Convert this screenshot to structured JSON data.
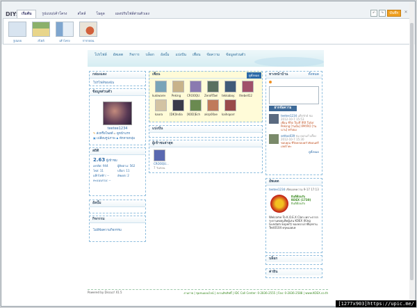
{
  "diy": {
    "title": "DIY:",
    "tabs": [
      "เริ่มต้น",
      "รูปแบบ/เค้าโครง",
      "สไตล์",
      "โมดูล",
      "แผงปรับไฟล์ส่วนตัวเอง"
    ],
    "save_label": "บันทึก",
    "layouts": [
      {
        "label": "รูปแบบ",
        "color": "#d8e4f0"
      },
      {
        "label": "สไตล์",
        "color": "#8bb06a"
      },
      {
        "label": "เค้าโครง",
        "color": "#7fa6cf"
      },
      {
        "label": "การกลอน",
        "color": "#d2603a"
      }
    ]
  },
  "nav": {
    "items": [
      "โปรไฟล์",
      "อัพเดต",
      "กิจการ",
      "บล็อก",
      "อัลบั้ม",
      "แบ่งปัน",
      "เพื่อน",
      "ข้อความ",
      "ข้อมูลส่วนตัว"
    ]
  },
  "left": {
    "box1_title": "กล่องแดง",
    "box1_link": "โปรไฟล์ของฉัน",
    "box2_title": "ข้อมูลส่วนตัว",
    "username": "teetee1234",
    "links": [
      "ส่งหรือโพสต์",
      "ดูหน้าแรก",
      "เปลี่ยนรูปภาพ",
      "ทักทายกลุ่ม"
    ],
    "box3_title": "สถิติ",
    "stat_main": "2.63",
    "stat_main_label": "ผู้เข้าชม",
    "stats": [
      "เครดิต: 944",
      "ผู้ติดตาม: 562",
      "โพส: 11",
      "บล็อก: 11",
      "แท็กไฟฟ้า: --",
      "อัพเดต: 2",
      "คะแนนรวม: --"
    ],
    "box4_title": "อัลบั้ม",
    "box5_title": "กิจกรรม",
    "box5_link": "ไม่มีข้อความกิจกรรม"
  },
  "center": {
    "friends_title": "เพื่อน",
    "friends_tag": "ดูทั้งหมด",
    "friends": [
      "kukiwaree",
      "Peking",
      "CROOQU...",
      "ZeroRTaeb...",
      "tekkaboy37",
      "thebell126",
      "kaora",
      "[DK]Indiana",
      "[KOD]Ech...",
      "akrp00ae79",
      "kaihoporn"
    ],
    "share_title": "แบ่งปัน",
    "visitors_title": "ผู้เข้าชมล่าสุด",
    "visitor_name": "CROOQU...",
    "visitor_time": "7 วันก่อน"
  },
  "right": {
    "wall_title": "ทางหน้าบ้าน",
    "wall_more": "ทั้งหมด",
    "post_button": "ฝากข้อความ",
    "posts": [
      {
        "name": "teetee1234",
        "meta": "แท็กรักษ์ ชม 2012-10-7 15:53",
        "text": "เพื่อน ชีวิต Tsuff IRR Tutor Peking [วันนั้น] IPAYRO [วันนาน] ครับผม"
      },
      {
        "name": "settoo039",
        "meta": "ชม ดอกแก้วเลี้ยง 2012-10-7 15:30",
        "text": "ขอบคุณ ชีวิตครอบครัวฟังดนตรีเลยจ้าคะ"
      }
    ],
    "posts_more": "ดูทั้งหมด",
    "feed_title": "อัพเดต",
    "feed_user": "teetee1234",
    "feed_meta": "เขียนบทความ 9-17 17:13",
    "feed_headline": "KOEX (1730)",
    "feed_headline_sub": "ยินดีต้อนรับ",
    "feed_caption": "ยินดีต้อนรับ",
    "feed_text": "Welcome To K.O.E.X Clan เพราะการกระดานคอยแพ็คผู้เล่น KOEX (King Gundam Expert) ของพวกเราที่ทุกท่าน Test0104 ครุคแอดเพ",
    "box3_title": "บล็อก",
    "box4_title": "ค่ายิน"
  },
  "footer": {
    "left": "Powered by Discuz! X1.5",
    "right": "งานกาย | ชุมชนออนไลน์ | สงวนลิขสิทธิ์ | IDC Call Center: 0-2836-2555 | Fax: 0-2836-2588 | www.KOEX.co.th"
  },
  "watermark": "[1277x903]https://upic.me/"
}
